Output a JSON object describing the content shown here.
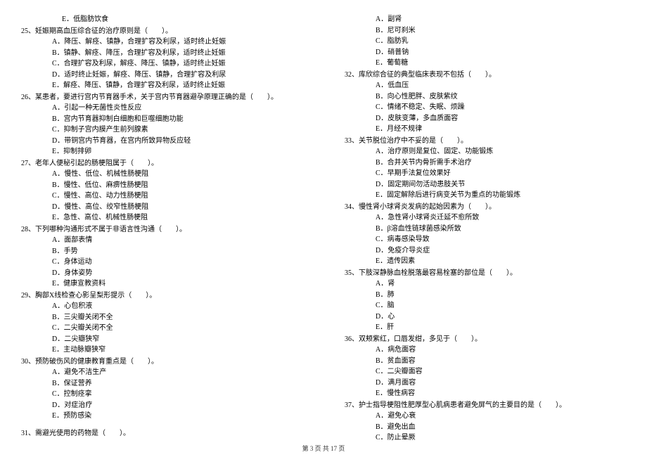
{
  "left": {
    "preE": "E．低脂肪饮食",
    "q25": "25、妊娠期高血压综合征的治疗原则是（　　）。",
    "q25a": "A．降压、解痉、镇静，合理扩容及利尿，适时终止妊娠",
    "q25b": "B．镇静、解痉、降压，合理扩容及利尿，适时终止妊娠",
    "q25c": "C．合理扩容及利尿，解痉、降压、镇静，适时终止妊娠",
    "q25d": "D．适时终止妊娠，解痉、降压、镇静，合理扩容及利尿",
    "q25e": "E．解痉、降压、镇静，合理扩容及利尿，适时终止妊娠",
    "q26": "26、某患者，要进行宫内节育器手术，关于宫内节育器避孕原理正确的是（　　）。",
    "q26a": "A．引起一种无菌性炎性反应",
    "q26b": "B．宫内节育器抑制白细胞和巨噬细胞功能",
    "q26c": "C．抑制子宫内膜产生前列腺素",
    "q26d": "D．带铜宫内节育器，在宫内所致异物反应轻",
    "q26e": "E．抑制排卵",
    "q27": "27、老年人便秘引起的肠梗阻属于（　　）。",
    "q27a": "A．慢性、低位、机械性肠梗阻",
    "q27b": "B．慢性、低位、麻痹性肠梗阻",
    "q27c": "C．慢性、高位、动力性肠梗阻",
    "q27d": "D．慢性、高位、绞窄性肠梗阻",
    "q27e": "E．急性、高位、机械性肠梗阻",
    "q28": "28、下列哪种沟通形式不属于非语言性沟通（　　）。",
    "q28a": "A．面部表情",
    "q28b": "B．手势",
    "q28c": "C．身体运动",
    "q28d": "D．身体姿势",
    "q28e": "E．健康宣教资料",
    "q29": "29、胸部X线检查心影呈梨形提示（　　）。",
    "q29a": "A．心包积液",
    "q29b": "B．三尖瓣关闭不全",
    "q29c": "C．二尖瓣关闭不全",
    "q29d": "D．二尖瓣狭窄",
    "q29e": "E．主动脉瓣狭窄",
    "q30": "30、预防破伤风的健康教育重点是（　　）。",
    "q30a": "A．避免不洁生产",
    "q30b": "B．保证营养",
    "q30c": "C．控制痉挛",
    "q30d": "D．对症治疗",
    "q30e": "E．预防感染",
    "q31": "31、需避光使用的药物是（　　）。"
  },
  "right": {
    "q31a": "A．副肾",
    "q31b": "B．尼可刹米",
    "q31c": "C．脂肪乳",
    "q31d": "D．硝普钠",
    "q31e": "E．葡萄糖",
    "q32": "32、库欣综合征的典型临床表现不包括（　　）。",
    "q32a": "A．低血压",
    "q32b": "B．向心性肥胖、皮肤紫纹",
    "q32c": "C．情绪不稳定、失眠、烦躁",
    "q32d": "D．皮肤变薄，多血质面容",
    "q32e": "E．月经不规律",
    "q33": "33、关节脱位治疗中不妥的是（　　）。",
    "q33a": "A．治疗原则是复位、固定、功能锻炼",
    "q33b": "B．合并关节内骨折需手术治疗",
    "q33c": "C．早期手法复位效果好",
    "q33d": "D．固定期间勿活动患肢关节",
    "q33e": "E．固定解除后进行病变关节为重点的功能锻炼",
    "q34": "34、慢性肾小球肾炎发病的起始因素为（　　）。",
    "q34a": "A．急性肾小球肾炎迁延不愈所致",
    "q34b": "B．β溶血性链球菌感染所致",
    "q34c": "C．病毒感染导致",
    "q34d": "D．免疫介导炎症",
    "q34e": "E．遗传因素",
    "q35": "35、下肢深静脉血栓脱落最容易栓塞的部位是（　　）。",
    "q35a": "A．肾",
    "q35b": "B．肺",
    "q35c": "C．脑",
    "q35d": "D．心",
    "q35e": "E．肝",
    "q36": "36、双颊紫红，口唇发绀，多见于（　　）。",
    "q36a": "A．病危面容",
    "q36b": "B．贫血面容",
    "q36c": "C．二尖瓣面容",
    "q36d": "D．满月面容",
    "q36e": "E．慢性病容",
    "q37": "37、护士指导梗阻性肥厚型心肌病患者避免屏气的主要目的是（　　）。",
    "q37a": "A．避免心衰",
    "q37b": "B．避免出血",
    "q37c": "C．防止晕厥"
  },
  "footer": "第 3 页 共 17 页"
}
